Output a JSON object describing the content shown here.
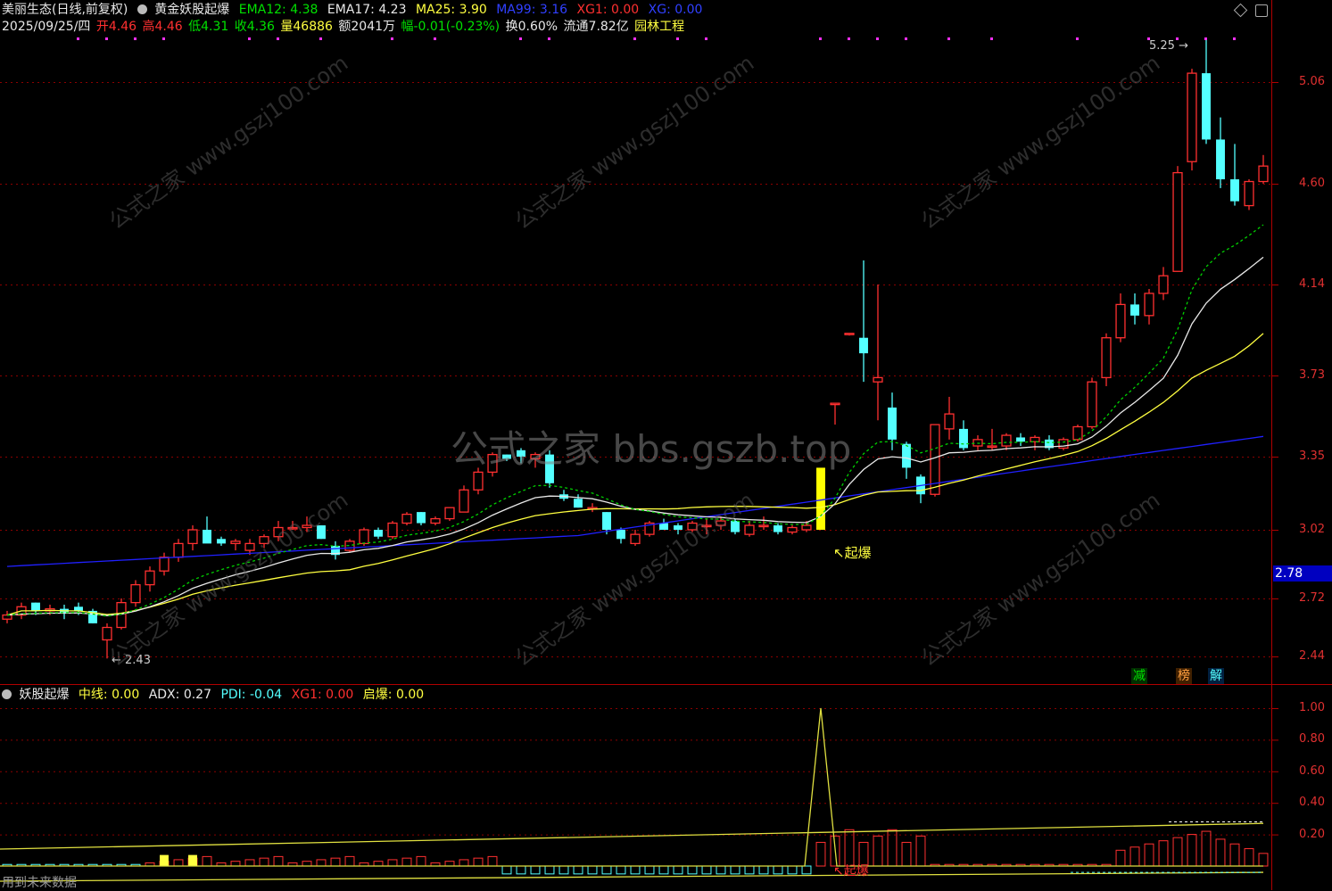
{
  "header": {
    "stock": "美丽生态(日线,前复权)",
    "formula": "黄金妖股起爆",
    "ema12": "EMA12: 4.38",
    "ema17": "EMA17: 4.23",
    "ma25": "MA25: 3.90",
    "ma99": "MA99: 3.16",
    "xg1": "XG1: 0.00",
    "xg": "XG: 0.00"
  },
  "info": {
    "date": "2025/09/25/四",
    "open": "开4.46",
    "high": "高4.46",
    "low": "低4.31",
    "close": "收4.36",
    "vol": "量46886",
    "amount": "额2041万",
    "change": "幅-0.01(-0.23%)",
    "turnover": "换0.60%",
    "float": "流通7.82亿",
    "sector": "园林工程"
  },
  "price_axis": [
    "5.06",
    "4.60",
    "4.14",
    "3.73",
    "3.35",
    "3.02",
    "2.72",
    "2.44"
  ],
  "current_price": "2.78",
  "annotations": {
    "peak": "5.25",
    "trough": "2.43",
    "signal": "起爆",
    "signal2": "起爆"
  },
  "tags": {
    "reduce": "减",
    "rank": "榜",
    "unlock": "解"
  },
  "indicator": {
    "name": "妖股起爆",
    "mid": "中线: 0.00",
    "adx": "ADX: 0.27",
    "pdi": "PDI: -0.04",
    "xg1": "XG1: 0.00",
    "qibao": "启爆: 0.00"
  },
  "indicator_axis": [
    "1.00",
    "0.80",
    "0.60",
    "0.40",
    "0.20"
  ],
  "footer": {
    "note": "用到未来数据"
  },
  "watermark": {
    "center": "公式之家 bbs.gszb.top",
    "tile": "公式之家",
    "url": "www.gszj100.com"
  },
  "colors": {
    "up": "#ff3030",
    "down": "#54ffff",
    "ema": "#00d000",
    "ma25": "#ffff40",
    "ma99": "#2020ff",
    "grid": "#8b0000"
  },
  "chart_data": {
    "type": "candlestick",
    "candles": [
      [
        2.62,
        2.66,
        2.6,
        2.64
      ],
      [
        2.64,
        2.7,
        2.62,
        2.68
      ],
      [
        2.7,
        2.7,
        2.64,
        2.66
      ],
      [
        2.66,
        2.69,
        2.64,
        2.67
      ],
      [
        2.67,
        2.69,
        2.62,
        2.65
      ],
      [
        2.68,
        2.7,
        2.64,
        2.66
      ],
      [
        2.66,
        2.67,
        2.6,
        2.6
      ],
      [
        2.52,
        2.6,
        2.43,
        2.58
      ],
      [
        2.58,
        2.72,
        2.57,
        2.7
      ],
      [
        2.7,
        2.8,
        2.68,
        2.78
      ],
      [
        2.78,
        2.86,
        2.75,
        2.84
      ],
      [
        2.84,
        2.92,
        2.82,
        2.9
      ],
      [
        2.9,
        2.98,
        2.88,
        2.96
      ],
      [
        2.96,
        3.04,
        2.93,
        3.02
      ],
      [
        3.02,
        3.08,
        2.98,
        2.96
      ],
      [
        2.98,
        2.99,
        2.95,
        2.96
      ],
      [
        2.96,
        2.98,
        2.93,
        2.97
      ],
      [
        2.93,
        2.98,
        2.91,
        2.96
      ],
      [
        2.96,
        3.0,
        2.94,
        2.99
      ],
      [
        2.99,
        3.06,
        2.97,
        3.03
      ],
      [
        3.03,
        3.06,
        3.02,
        3.03
      ],
      [
        3.03,
        3.08,
        3.01,
        3.04
      ],
      [
        3.04,
        3.04,
        2.98,
        2.98
      ],
      [
        2.95,
        2.97,
        2.89,
        2.91
      ],
      [
        2.93,
        2.98,
        2.92,
        2.97
      ],
      [
        2.96,
        3.03,
        2.95,
        3.02
      ],
      [
        3.02,
        3.03,
        2.98,
        2.99
      ],
      [
        2.99,
        3.06,
        2.98,
        3.05
      ],
      [
        3.05,
        3.1,
        3.04,
        3.09
      ],
      [
        3.1,
        3.1,
        3.04,
        3.05
      ],
      [
        3.05,
        3.08,
        3.04,
        3.07
      ],
      [
        3.07,
        3.12,
        3.06,
        3.12
      ],
      [
        3.1,
        3.22,
        3.1,
        3.2
      ],
      [
        3.2,
        3.3,
        3.18,
        3.28
      ],
      [
        3.28,
        3.37,
        3.26,
        3.36
      ],
      [
        3.36,
        3.36,
        3.33,
        3.34
      ],
      [
        3.38,
        3.39,
        3.32,
        3.35
      ],
      [
        3.34,
        3.37,
        3.3,
        3.36
      ],
      [
        3.36,
        3.38,
        3.21,
        3.23
      ],
      [
        3.18,
        3.2,
        3.15,
        3.16
      ],
      [
        3.16,
        3.18,
        3.12,
        3.12
      ],
      [
        3.12,
        3.14,
        3.1,
        3.12
      ],
      [
        3.1,
        3.1,
        3.0,
        3.02
      ],
      [
        3.02,
        3.03,
        2.96,
        2.98
      ],
      [
        2.96,
        3.02,
        2.95,
        3.0
      ],
      [
        3.0,
        3.06,
        2.99,
        3.05
      ],
      [
        3.05,
        3.07,
        3.02,
        3.02
      ],
      [
        3.04,
        3.05,
        3.0,
        3.02
      ],
      [
        3.02,
        3.06,
        3.01,
        3.05
      ],
      [
        3.04,
        3.07,
        3.0,
        3.04
      ],
      [
        3.04,
        3.08,
        3.02,
        3.06
      ],
      [
        3.06,
        3.07,
        3.0,
        3.01
      ],
      [
        3.0,
        3.06,
        2.99,
        3.04
      ],
      [
        3.04,
        3.08,
        3.02,
        3.04
      ],
      [
        3.04,
        3.05,
        3.0,
        3.01
      ],
      [
        3.01,
        3.04,
        3.0,
        3.03
      ],
      [
        3.02,
        3.06,
        3.01,
        3.04
      ],
      [
        3.02,
        3.3,
        3.02,
        3.3
      ],
      [
        3.6,
        3.6,
        3.5,
        3.6
      ],
      [
        3.92,
        3.92,
        3.91,
        3.92
      ],
      [
        3.9,
        4.25,
        3.7,
        3.83
      ],
      [
        3.7,
        4.14,
        3.52,
        3.72
      ],
      [
        3.58,
        3.65,
        3.38,
        3.43
      ],
      [
        3.41,
        3.42,
        3.25,
        3.3
      ],
      [
        3.26,
        3.27,
        3.14,
        3.18
      ],
      [
        3.18,
        3.5,
        3.17,
        3.5
      ],
      [
        3.48,
        3.63,
        3.43,
        3.55
      ],
      [
        3.48,
        3.52,
        3.38,
        3.39
      ],
      [
        3.4,
        3.45,
        3.38,
        3.43
      ],
      [
        3.4,
        3.48,
        3.38,
        3.4
      ],
      [
        3.4,
        3.46,
        3.38,
        3.45
      ],
      [
        3.44,
        3.46,
        3.4,
        3.42
      ],
      [
        3.42,
        3.45,
        3.38,
        3.44
      ],
      [
        3.43,
        3.45,
        3.38,
        3.39
      ],
      [
        3.39,
        3.44,
        3.38,
        3.43
      ],
      [
        3.43,
        3.5,
        3.42,
        3.49
      ],
      [
        3.49,
        3.72,
        3.48,
        3.7
      ],
      [
        3.72,
        3.92,
        3.68,
        3.9
      ],
      [
        3.9,
        4.1,
        3.88,
        4.05
      ],
      [
        4.05,
        4.1,
        3.96,
        4.0
      ],
      [
        4.0,
        4.12,
        3.96,
        4.1
      ],
      [
        4.1,
        4.22,
        4.07,
        4.18
      ],
      [
        4.2,
        4.68,
        4.2,
        4.65
      ],
      [
        4.7,
        5.12,
        4.66,
        5.1
      ],
      [
        5.1,
        5.25,
        4.78,
        4.8
      ],
      [
        4.8,
        4.9,
        4.58,
        4.62
      ],
      [
        4.62,
        4.78,
        4.5,
        4.52
      ],
      [
        4.5,
        4.62,
        4.48,
        4.61
      ],
      [
        4.61,
        4.73,
        4.6,
        4.68
      ]
    ],
    "signal_bar_index": 57
  }
}
